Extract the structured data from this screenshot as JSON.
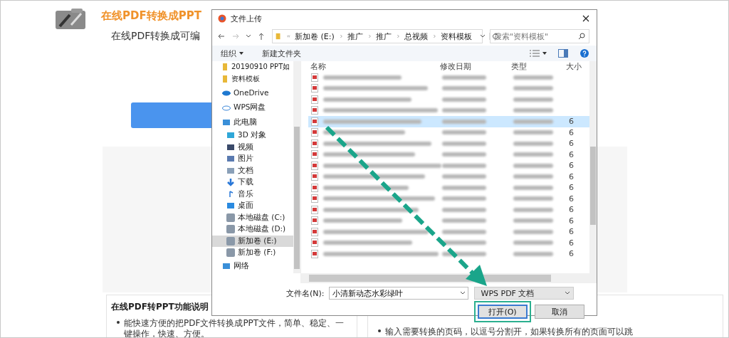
{
  "page": {
    "title": "在线PDF转换成PPT",
    "subtitle": "在线PDF转换成可编",
    "info_left": {
      "heading": "在线PDF转PPT功能说明",
      "bullets": [
        "能快速方便的把PDF文件转换成PPT文件，简单、稳定、一键操作，快速、方便。"
      ]
    },
    "info_right": {
      "bullets": [
        "输入需要转换的页码，以逗号分割开，如果转换所有的页面可以跳"
      ]
    }
  },
  "dialog": {
    "title": "文件上传",
    "address": [
      "新加卷 (E:)",
      "推广",
      "推广",
      "总视频",
      "资料模板"
    ],
    "search": {
      "placeholder": "搜索\"资料模板\""
    },
    "organize": "组织",
    "new_folder": "新建文件夹",
    "nav": [
      {
        "label": "20190910 PPT如",
        "kind": "folder",
        "selected": false
      },
      {
        "label": "资料模板",
        "kind": "folder",
        "selected": false
      },
      {
        "label": "OneDrive",
        "kind": "onedrive",
        "selected": false
      },
      {
        "label": "WPS网盘",
        "kind": "cloud",
        "selected": false
      },
      {
        "label": "此电脑",
        "kind": "pc",
        "selected": false,
        "children": [
          {
            "label": "3D 对象",
            "kind": "cube",
            "selected": false
          },
          {
            "label": "视频",
            "kind": "video",
            "selected": false
          },
          {
            "label": "图片",
            "kind": "picture",
            "selected": false
          },
          {
            "label": "文档",
            "kind": "document",
            "selected": false
          },
          {
            "label": "下载",
            "kind": "download",
            "selected": false
          },
          {
            "label": "音乐",
            "kind": "music",
            "selected": false
          },
          {
            "label": "桌面",
            "kind": "desktop",
            "selected": false
          },
          {
            "label": "本地磁盘 (C:)",
            "kind": "drive",
            "selected": false
          },
          {
            "label": "本地磁盘 (D:)",
            "kind": "drive",
            "selected": false
          },
          {
            "label": "新加卷 (E:)",
            "kind": "drive",
            "selected": true
          },
          {
            "label": "新加卷 (F:)",
            "kind": "drive",
            "selected": false
          }
        ]
      },
      {
        "label": "网络",
        "kind": "network",
        "selected": false
      }
    ],
    "columns": [
      "名称",
      "修改日期",
      "类型",
      "大小"
    ],
    "files": [
      {
        "selected": false
      },
      {
        "selected": false
      },
      {
        "selected": false
      },
      {
        "selected": false
      },
      {
        "selected": true,
        "size": "6"
      },
      {
        "selected": false,
        "size": "6"
      },
      {
        "selected": false,
        "size": "6"
      },
      {
        "selected": false,
        "size": "6"
      },
      {
        "selected": false,
        "size": "6"
      },
      {
        "selected": false,
        "size": "6"
      },
      {
        "selected": false,
        "size": "6"
      },
      {
        "selected": false,
        "size": "6"
      },
      {
        "selected": false,
        "size": "6"
      },
      {
        "selected": false,
        "size": "6"
      },
      {
        "selected": false,
        "size": "6"
      },
      {
        "selected": false,
        "size": "6"
      },
      {
        "selected": false,
        "size": "6"
      }
    ],
    "filename": {
      "label": "文件名(N):",
      "value": "小清新动态水彩绿叶"
    },
    "filter": "WPS PDF 文档",
    "buttons": [
      {
        "label": "打开(O)",
        "kind": "primary",
        "highlighted": true
      },
      {
        "label": "取消",
        "kind": "normal",
        "highlighted": false
      }
    ]
  }
}
